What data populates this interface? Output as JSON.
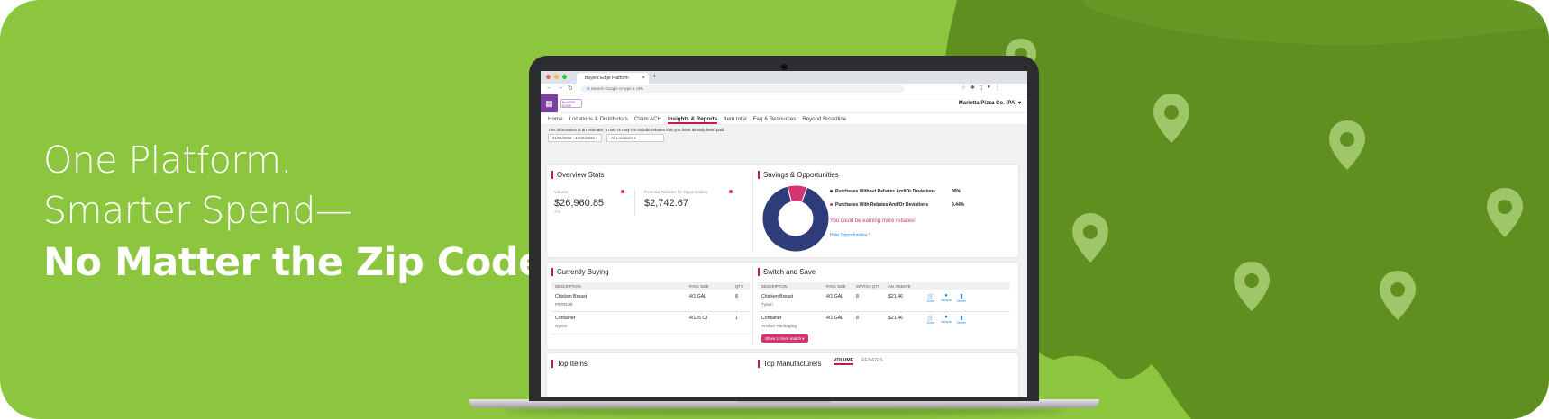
{
  "headline": {
    "line1": "One Platform.",
    "line2": "Smarter Spend—",
    "line3": "No Matter the Zip Code."
  },
  "colors": {
    "background": "#8cc63f",
    "map": "#5e8f1f",
    "pin": "#9fc76a",
    "accent": "#c2185b",
    "brand": "#7b3fa0"
  },
  "browser": {
    "tab_title": "Buyers Edge Platform",
    "tab_close": "×",
    "new_tab": "+",
    "nav_icons": [
      "←",
      "→",
      "↻"
    ],
    "address_placeholder": "Search Google or type a URL",
    "address_icon": "G"
  },
  "app": {
    "logo_text": "BUYERS EDGE",
    "grid_icon": "apps-grid-icon",
    "account": "Marietta Pizza Co. (PA) ▾",
    "menu": [
      "Home",
      "Locations & Distributors",
      "Claim ACH",
      "Insights & Reports",
      "Item Intel",
      "Faq & Resources",
      "Beyond Broadline"
    ],
    "menu_active": "Insights & Reports",
    "note": "This information is an estimate. It may or may not include rebates that you have already been paid.",
    "date_filter": "01/01/2022 - 12/31/2022 ▾",
    "location_filter": "All Locations ▾"
  },
  "overview": {
    "title": "Overview Stats",
    "volume_label": "Volume",
    "volume_value": "$26,960.85",
    "volume_sub": "YTD",
    "rebates_label": "Potential Rebates for Opportunities",
    "rebates_value": "$2,742.67"
  },
  "savings": {
    "title": "Savings & Opportunities",
    "legend": [
      {
        "label": "Purchases Without Rebates And/Or Deviations",
        "value": "90%",
        "color": "#2e3d7a"
      },
      {
        "label": "Purchases With Rebates And/Or Deviations",
        "value": "9.44%",
        "color": "#d63371"
      }
    ],
    "message": "You could be earning more rebates!",
    "link": "Hide Opportunities ^"
  },
  "chart_data": {
    "type": "pie",
    "categories": [
      "Purchases Without Rebates And/Or Deviations",
      "Purchases With Rebates And/Or Deviations"
    ],
    "values": [
      90,
      9.44
    ],
    "title": "Savings & Opportunities",
    "donut": true
  },
  "currently_buying": {
    "title": "Currently Buying",
    "headers": [
      "Description",
      "Pack Size",
      "Qty"
    ],
    "rows": [
      {
        "desc": "Chicken Breast",
        "brand": "PERDUE",
        "pack": "4/1 GAL",
        "qty": "8"
      },
      {
        "desc": "Container",
        "brand": "Sysco",
        "pack": "4/125 CT",
        "qty": "1"
      }
    ]
  },
  "switch_save": {
    "title": "Switch and Save",
    "headers": [
      "Description",
      "Pack Size",
      "Switch Qty",
      "An. Rebate"
    ],
    "rows": [
      {
        "desc": "Chicken Breast",
        "brand": "Tyson",
        "pack": "4/1 GAL",
        "qty": "8",
        "rebate": "$21.46"
      },
      {
        "desc": "Container",
        "brand": "Anchor Packaging",
        "pack": "4/1 GAL",
        "qty": "8",
        "rebate": "$21.46"
      }
    ],
    "actions": [
      "Order",
      "Sample",
      "Delete"
    ],
    "more_button": "Show 1 more match ▾"
  },
  "bottom": {
    "top_items": "Top Items",
    "top_manufacturers": "Top Manufacturers",
    "tab_volume": "VOLUME",
    "tab_rebates": "REBATES"
  }
}
